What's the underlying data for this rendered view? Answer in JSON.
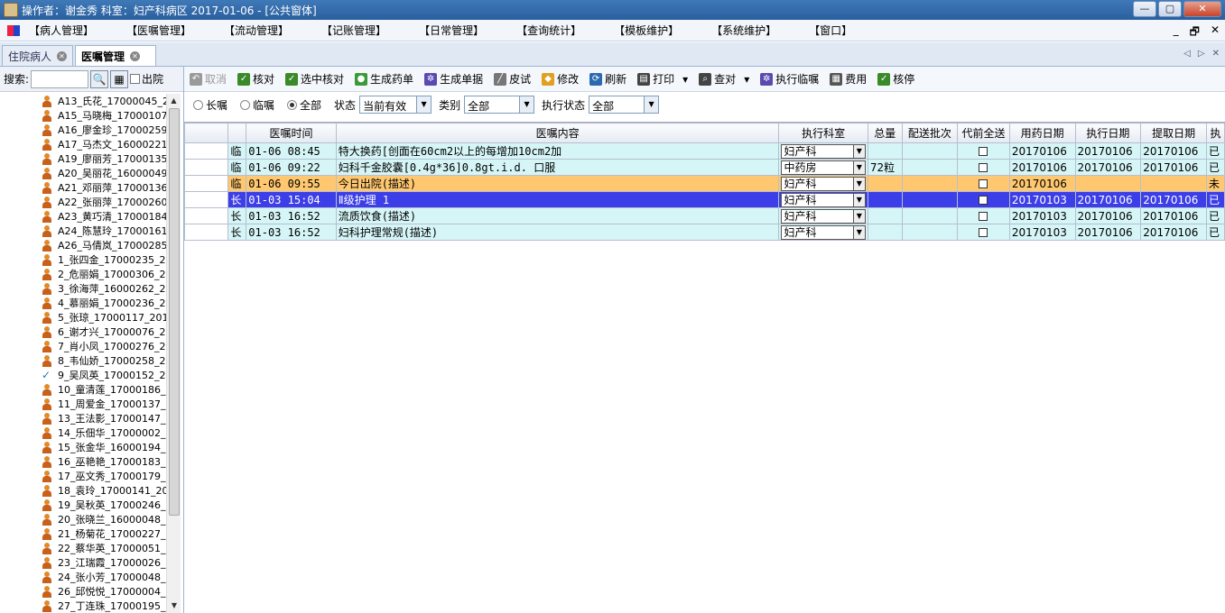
{
  "window": {
    "title": "操作者：谢金秀  科室：妇产科病区  2017-01-06 - [公共窗体]",
    "min": "—",
    "max": "▢",
    "close": "✕"
  },
  "menu": {
    "items": [
      "【病人管理】",
      "【医嘱管理】",
      "【流动管理】",
      "【记账管理】",
      "【日常管理】",
      "【查询统计】",
      "【模板维护】",
      "【系统维护】",
      "【窗口】"
    ],
    "right": [
      "_",
      "🗗",
      "✕"
    ]
  },
  "tabs": [
    {
      "label": "住院病人"
    },
    {
      "label": "医嘱管理"
    }
  ],
  "left": {
    "search_label": "搜索:",
    "discharged_label": "出院",
    "patients": [
      "A13_氏花_17000045_20",
      "A15_马晓梅_17000107_",
      "A16_廖金珍_17000259_",
      "A17_马杰文_16000221_",
      "A19_廖丽芳_17000135_",
      "A20_吴丽花_16000049_",
      "A21_邓丽萍_17000136_",
      "A22_张丽萍_17000260_",
      "A23_黄巧清_17000184_",
      "A24_陈慧玲_17000161_",
      "A26_马倩岚_17000285_",
      "1_张四金_17000235_20",
      "2_危丽娟_17000306_20",
      "3_徐海萍_16000262_20",
      "4_慕丽娟_17000236_20",
      "5_张琼_17000117_201",
      "6_谢才兴_17000076_20",
      "7_肖小凤_17000276_20",
      "8_韦仙娇_17000258_20",
      "9_吴凤英_17000152_20",
      "10_童清莲_17000186_2",
      "11_周爱金_17000137_2",
      "13_王法影_17000147_2",
      "14_乐佃华_17000002_2",
      "15_张金华_16000194_2",
      "16_巫艳艳_17000183_2",
      "17_巫文秀_17000179_2",
      "18_袁玲_17000141_20",
      "19_吴秋英_17000246_2",
      "20_张晓兰_16000048_2",
      "21_杨菊花_17000227_2",
      "22_蔡华英_17000051_2",
      "23_江瑞霞_17000026_2",
      "24_张小芳_17000048_2",
      "26_邱悦悦_17000004_2",
      "27_丁连珠_17000195_2"
    ],
    "checked_index": 19
  },
  "toolbar": [
    {
      "label": "取消",
      "icon": "undo-icon",
      "color": "#9a9a9a",
      "disabled": true
    },
    {
      "label": "核对",
      "icon": "check-icon",
      "color": "#3a8a2a"
    },
    {
      "label": "选中核对",
      "icon": "check-icon",
      "color": "#3a8a2a"
    },
    {
      "label": "生成药单",
      "icon": "pills-icon",
      "color": "#3a9a3a"
    },
    {
      "label": "生成单据",
      "icon": "gear-icon",
      "color": "#5a4ab0"
    },
    {
      "label": "皮试",
      "icon": "syringe-icon",
      "color": "#777777"
    },
    {
      "label": "修改",
      "icon": "eraser-icon",
      "color": "#e0a020"
    },
    {
      "label": "刷新",
      "icon": "refresh-icon",
      "color": "#2a6ab0"
    },
    {
      "label": "打印",
      "icon": "printer-icon",
      "color": "#444444",
      "dropdown": true
    },
    {
      "label": "查对",
      "icon": "magnifier-icon",
      "color": "#444444",
      "dropdown": true
    },
    {
      "label": "执行临嘱",
      "icon": "gear-icon",
      "color": "#5a4ab0"
    },
    {
      "label": "费用",
      "icon": "calculator-icon",
      "color": "#555555"
    },
    {
      "label": "核停",
      "icon": "check-icon",
      "color": "#3a8a2a"
    }
  ],
  "filters": {
    "radios": [
      {
        "label": "长嘱",
        "on": false
      },
      {
        "label": "临嘱",
        "on": false
      },
      {
        "label": "全部",
        "on": true
      }
    ],
    "status_label": "状态",
    "status_value": "当前有效",
    "type_label": "类别",
    "type_value": "全部",
    "exec_label": "执行状态",
    "exec_value": "全部"
  },
  "grid": {
    "columns": [
      "医嘱时间",
      "医嘱内容",
      "执行科室",
      "总量",
      "配送批次",
      "代前全送",
      "用药日期",
      "执行日期",
      "提取日期",
      "执"
    ],
    "rows": [
      {
        "kind": "临",
        "time": "01-06 08:45",
        "content": "特大换药[创面在60cm2以上的每增加10cm2加",
        "dept": "妇产科",
        "qty": "",
        "batch": "",
        "use": "20170106",
        "exec": "20170106",
        "fetch": "20170106",
        "st": "已",
        "style": "r-cyan",
        "current": false
      },
      {
        "kind": "临",
        "time": "01-06 09:22",
        "content": "妇科千金胶囊[0.4g*36]0.8gt.i.d. 口服",
        "dept": "中药房",
        "qty": "72粒",
        "batch": "",
        "use": "20170106",
        "exec": "20170106",
        "fetch": "20170106",
        "st": "已",
        "style": "r-cyan",
        "current": false
      },
      {
        "kind": "临",
        "time": "01-06 09:55",
        "content": "今日出院(描述)",
        "dept": "妇产科",
        "qty": "",
        "batch": "",
        "use": "20170106",
        "exec": "",
        "fetch": "",
        "st": "未",
        "style": "r-orange",
        "current": false
      },
      {
        "kind": "长",
        "time": "01-03 15:04",
        "content": "Ⅱ级护理   1",
        "dept": "妇产科",
        "qty": "",
        "batch": "",
        "use": "20170103",
        "exec": "20170106",
        "fetch": "20170106",
        "st": "已",
        "style": "r-blue",
        "current": true
      },
      {
        "kind": "长",
        "time": "01-03 16:52",
        "content": "流质饮食(描述)",
        "dept": "妇产科",
        "qty": "",
        "batch": "",
        "use": "20170103",
        "exec": "20170106",
        "fetch": "20170106",
        "st": "已",
        "style": "r-cyan",
        "current": false
      },
      {
        "kind": "长",
        "time": "01-03 16:52",
        "content": "妇科护理常规(描述)",
        "dept": "妇产科",
        "qty": "",
        "batch": "",
        "use": "20170103",
        "exec": "20170106",
        "fetch": "20170106",
        "st": "已",
        "style": "r-cyan",
        "current": false
      }
    ]
  }
}
